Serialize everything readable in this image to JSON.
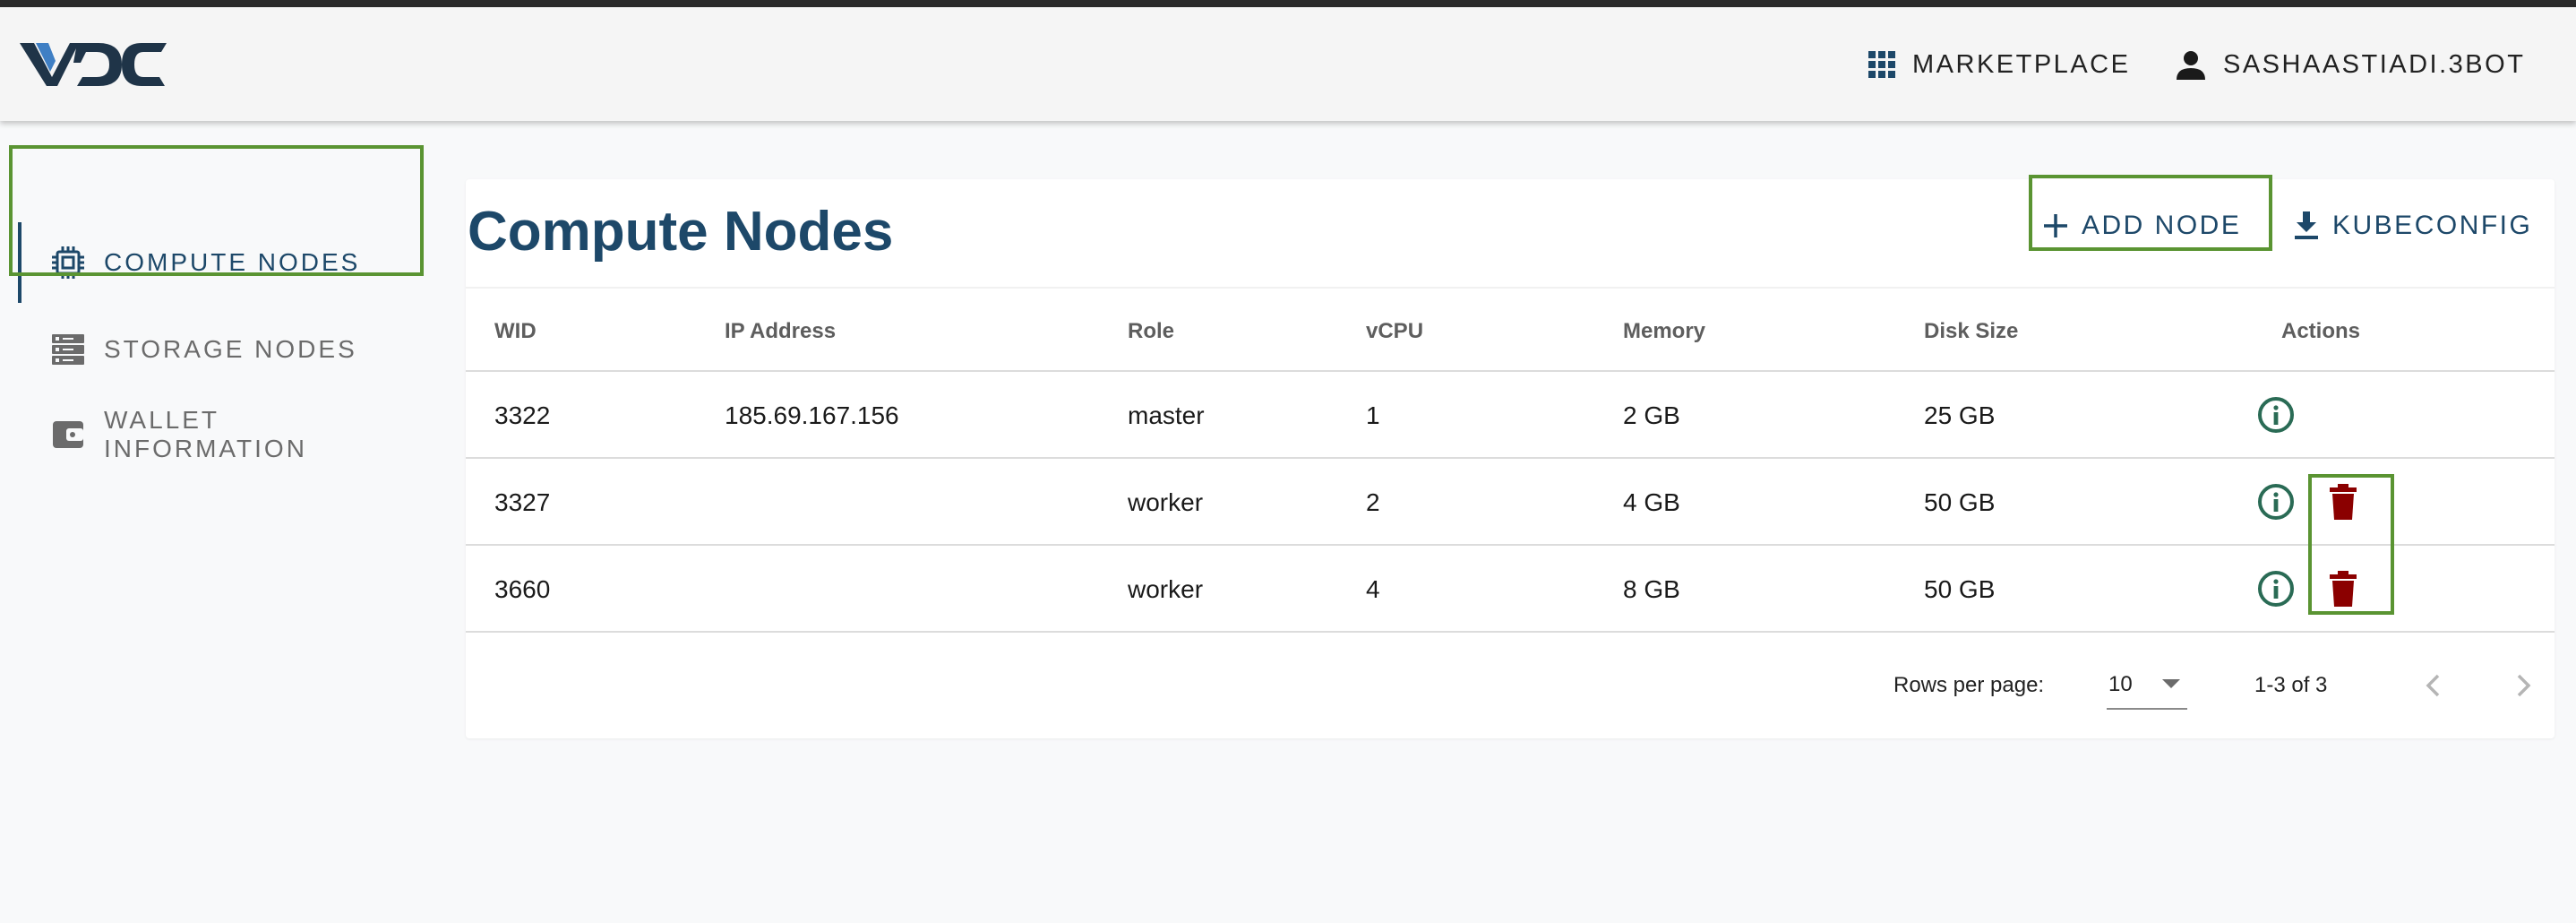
{
  "app": {
    "logo_text": "VDC",
    "marketplace_label": "MARKETPLACE",
    "marketplace_icon": "apps-grid-icon",
    "user_label": "SASHAASTIADI.3BOT",
    "user_icon": "person-icon"
  },
  "sidebar": {
    "items": [
      {
        "label": "COMPUTE NODES",
        "icon": "chip-icon",
        "active": true
      },
      {
        "label": "STORAGE NODES",
        "icon": "server-icon",
        "active": false
      },
      {
        "label": "WALLET INFORMATION",
        "icon": "wallet-icon",
        "active": false
      }
    ]
  },
  "main": {
    "title": "Compute Nodes",
    "add_node_label": "ADD NODE",
    "kubeconfig_label": "KUBECONFIG",
    "table": {
      "columns": [
        "WID",
        "IP Address",
        "Role",
        "vCPU",
        "Memory",
        "Disk Size",
        "Actions"
      ],
      "rows": [
        {
          "wid": "3322",
          "ip": "185.69.167.156",
          "role": "master",
          "vcpu": "1",
          "memory": "2 GB",
          "disk": "25 GB",
          "deletable": false
        },
        {
          "wid": "3327",
          "ip": "",
          "role": "worker",
          "vcpu": "2",
          "memory": "4 GB",
          "disk": "50 GB",
          "deletable": true
        },
        {
          "wid": "3660",
          "ip": "",
          "role": "worker",
          "vcpu": "4",
          "memory": "8 GB",
          "disk": "50 GB",
          "deletable": true
        }
      ]
    },
    "footer": {
      "rows_per_page_label": "Rows per page:",
      "rows_per_page_value": "10",
      "range": "1-3 of 3"
    }
  },
  "colors": {
    "primary": "#1d4869",
    "info_icon": "#2a6b55",
    "delete_icon": "#8b0000",
    "highlight": "#5a9432",
    "logo_blue": "#3f7fc4"
  }
}
